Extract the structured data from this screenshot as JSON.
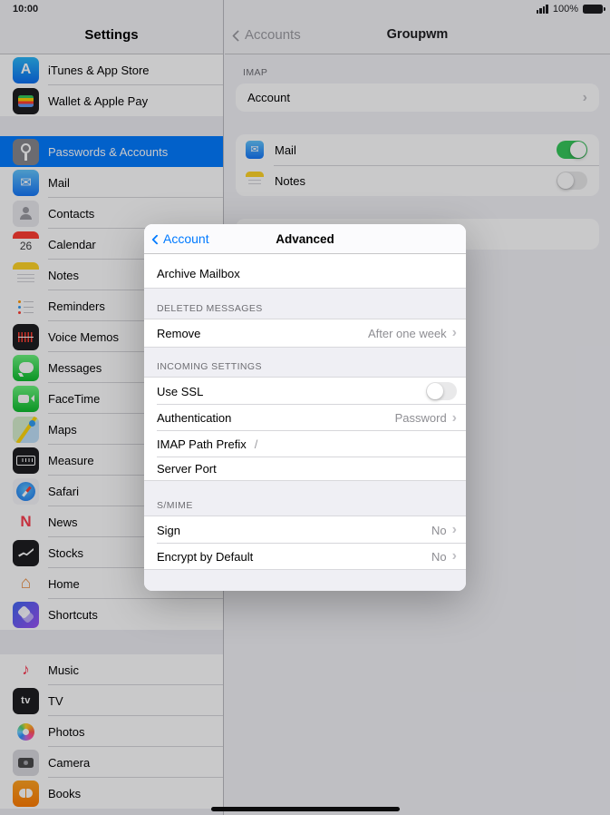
{
  "status_bar": {
    "time": "10:00",
    "battery_percent": "100%"
  },
  "colors": {
    "accent": "#007aff",
    "toggle_on": "#34c759",
    "selected_row": "#007aff",
    "dimmed_tint": "#9b9ba1"
  },
  "sidebar": {
    "title": "Settings",
    "items": [
      {
        "label": "iTunes & App Store",
        "icon": "app-store-icon"
      },
      {
        "label": "Wallet & Apple Pay",
        "icon": "wallet-icon"
      },
      {
        "label": "Passwords & Accounts",
        "icon": "key-icon",
        "selected": true
      },
      {
        "label": "Mail",
        "icon": "mail-icon"
      },
      {
        "label": "Contacts",
        "icon": "contacts-icon"
      },
      {
        "label": "Calendar",
        "icon": "calendar-icon"
      },
      {
        "label": "Notes",
        "icon": "notes-icon"
      },
      {
        "label": "Reminders",
        "icon": "reminders-icon"
      },
      {
        "label": "Voice Memos",
        "icon": "voice-memos-icon"
      },
      {
        "label": "Messages",
        "icon": "messages-icon"
      },
      {
        "label": "FaceTime",
        "icon": "facetime-icon"
      },
      {
        "label": "Maps",
        "icon": "maps-icon"
      },
      {
        "label": "Measure",
        "icon": "measure-icon"
      },
      {
        "label": "Safari",
        "icon": "safari-icon"
      },
      {
        "label": "News",
        "icon": "news-icon"
      },
      {
        "label": "Stocks",
        "icon": "stocks-icon"
      },
      {
        "label": "Home",
        "icon": "home-icon"
      },
      {
        "label": "Shortcuts",
        "icon": "shortcuts-icon"
      },
      {
        "label": "Music",
        "icon": "music-icon"
      },
      {
        "label": "TV",
        "icon": "tv-icon"
      },
      {
        "label": "Photos",
        "icon": "photos-icon"
      },
      {
        "label": "Camera",
        "icon": "camera-icon"
      },
      {
        "label": "Books",
        "icon": "books-icon"
      }
    ]
  },
  "detail": {
    "back_label": "Accounts",
    "title": "Groupwm",
    "imap_section_header": "IMAP",
    "account_row_label": "Account",
    "mail_toggle": {
      "label": "Mail",
      "on": true
    },
    "notes_toggle": {
      "label": "Notes",
      "on": false
    }
  },
  "modal": {
    "back_label": "Account",
    "title": "Advanced",
    "archive_row_label": "Archive Mailbox",
    "deleted_messages_header": "DELETED MESSAGES",
    "remove_label": "Remove",
    "remove_value": "After one week",
    "incoming_settings_header": "INCOMING SETTINGS",
    "use_ssl_label": "Use SSL",
    "use_ssl_on": false,
    "authentication_label": "Authentication",
    "authentication_value": "Password",
    "imap_path_prefix_label": "IMAP Path Prefix",
    "imap_path_prefix_value": "/",
    "server_port_label": "Server Port",
    "smime_header": "S/MIME",
    "sign_label": "Sign",
    "sign_value": "No",
    "encrypt_label": "Encrypt by Default",
    "encrypt_value": "No",
    "chevron": "›"
  }
}
